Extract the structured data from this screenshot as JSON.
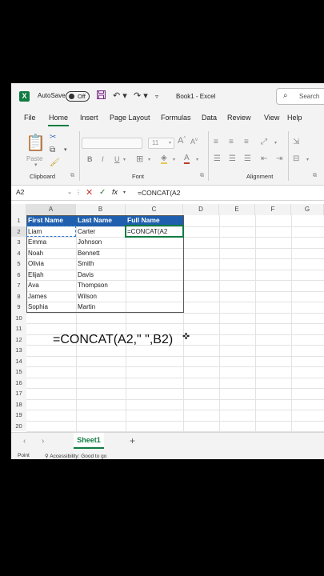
{
  "title_bar": {
    "logo": "X",
    "autosave_label": "AutoSave",
    "autosave_state": "Off",
    "doc_title": "Book1  -  Excel",
    "search_placeholder": "Search"
  },
  "menu": {
    "tabs": [
      "File",
      "Home",
      "Insert",
      "Page Layout",
      "Formulas",
      "Data",
      "Review",
      "View",
      "Help"
    ],
    "active": "Home"
  },
  "ribbon": {
    "clipboard_label": "Clipboard",
    "paste_label": "Paste",
    "font_label": "Font",
    "font_size": "11",
    "alignment_label": "Alignment"
  },
  "formula_bar": {
    "name_box": "A2",
    "fx": "fx",
    "content": "=CONCAT(A2"
  },
  "grid": {
    "columns": [
      "A",
      "B",
      "C",
      "D",
      "E",
      "F",
      "G"
    ],
    "rows": [
      "1",
      "2",
      "3",
      "4",
      "5",
      "6",
      "7",
      "8",
      "9",
      "10",
      "11",
      "12",
      "13",
      "14",
      "15",
      "16",
      "17",
      "18",
      "19",
      "20"
    ],
    "header": [
      "First Name",
      "Last Name",
      "Full Name"
    ],
    "data": [
      [
        "Liam",
        "Carter",
        "=CONCAT(A2"
      ],
      [
        "Emma",
        "Johnson",
        ""
      ],
      [
        "Noah",
        "Bennett",
        ""
      ],
      [
        "Olivia",
        "Smith",
        ""
      ],
      [
        "Elijah",
        "Davis",
        ""
      ],
      [
        "Ava",
        "Thompson",
        ""
      ],
      [
        "James",
        "Wilson",
        ""
      ],
      [
        "Sophia",
        "Martin",
        ""
      ]
    ],
    "overlay_formula": "=CONCAT(A2,\" \",B2)"
  },
  "sheets": {
    "tabs": [
      "Sheet1"
    ]
  },
  "status_bar": {
    "mode": "Point",
    "accessibility": "Accessibility: Good to go"
  },
  "colors": {
    "excel_green": "#107c41",
    "header_fill": "#1f5fae"
  }
}
